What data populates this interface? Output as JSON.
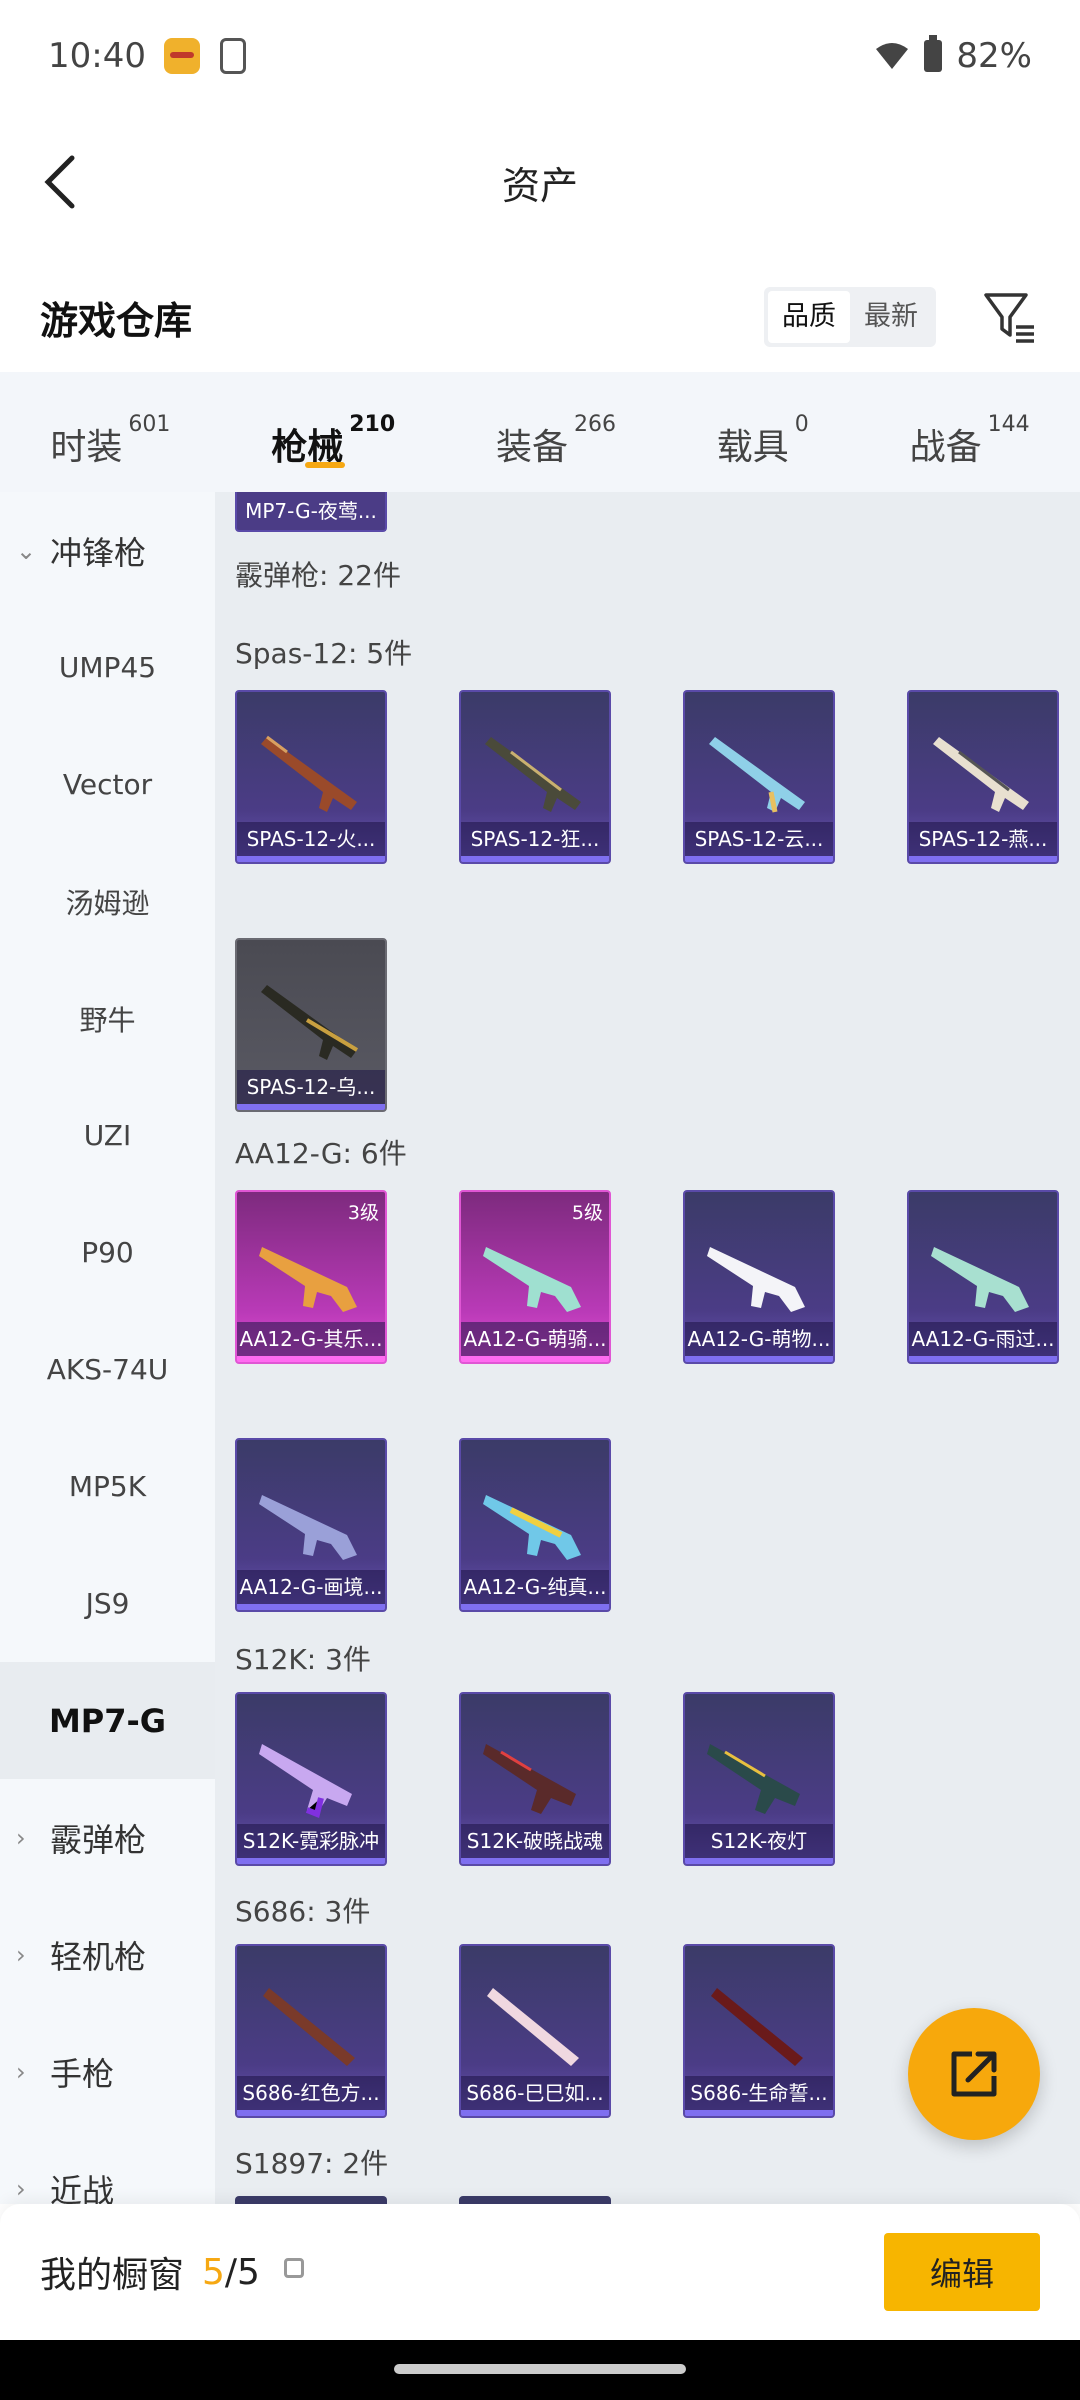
{
  "status_bar": {
    "time": "10:40",
    "battery": "82%"
  },
  "header": {
    "title": "资产"
  },
  "section": {
    "title": "游戏仓库",
    "sort_options": [
      "品质",
      "最新"
    ]
  },
  "tabs": [
    {
      "label": "时装",
      "count": "601"
    },
    {
      "label": "枪械",
      "count": "210"
    },
    {
      "label": "装备",
      "count": "266"
    },
    {
      "label": "载具",
      "count": "0"
    },
    {
      "label": "战备",
      "count": "144"
    }
  ],
  "sidebar": {
    "items": [
      {
        "label": "冲锋枪",
        "type": "group-open"
      },
      {
        "label": "UMP45"
      },
      {
        "label": "Vector"
      },
      {
        "label": "汤姆逊"
      },
      {
        "label": "野牛"
      },
      {
        "label": "UZI"
      },
      {
        "label": "P90"
      },
      {
        "label": "AKS-74U"
      },
      {
        "label": "MP5K"
      },
      {
        "label": "JS9"
      },
      {
        "label": "MP7-G",
        "active": true
      },
      {
        "label": "霰弹枪",
        "type": "group"
      },
      {
        "label": "轻机枪",
        "type": "group"
      },
      {
        "label": "手枪",
        "type": "group"
      },
      {
        "label": "近战",
        "type": "group"
      }
    ]
  },
  "main": {
    "top_partial": "MP7-G-夜莺...",
    "category_label": "霰弹枪: 22件",
    "groups": [
      {
        "label": "Spas-12: 5件",
        "items": [
          "SPAS-12-火...",
          "SPAS-12-狂...",
          "SPAS-12-云...",
          "SPAS-12-燕...",
          "SPAS-12-乌..."
        ]
      },
      {
        "label": "AA12-G: 6件",
        "items": [
          "AA12-G-其乐...",
          "AA12-G-萌骑...",
          "AA12-G-萌物...",
          "AA12-G-雨过...",
          "AA12-G-画境...",
          "AA12-G-纯真..."
        ],
        "levels": [
          "3级",
          "5级"
        ]
      },
      {
        "label": "S12K: 3件",
        "items": [
          "S12K-霓彩脉冲",
          "S12K-破晓战魂",
          "S12K-夜灯"
        ]
      },
      {
        "label": "S686: 3件",
        "items": [
          "S686-红色方...",
          "S686-巳巳如...",
          "S686-生命誓..."
        ]
      },
      {
        "label": "S1897: 2件",
        "items": []
      }
    ]
  },
  "bottom_bar": {
    "label": "我的橱窗",
    "current": "5",
    "total": "/5",
    "edit_label": "编辑"
  },
  "colors": {
    "accent": "#f7b500",
    "card_purple": "#4b3c86",
    "card_pink": "#b93ab7"
  }
}
